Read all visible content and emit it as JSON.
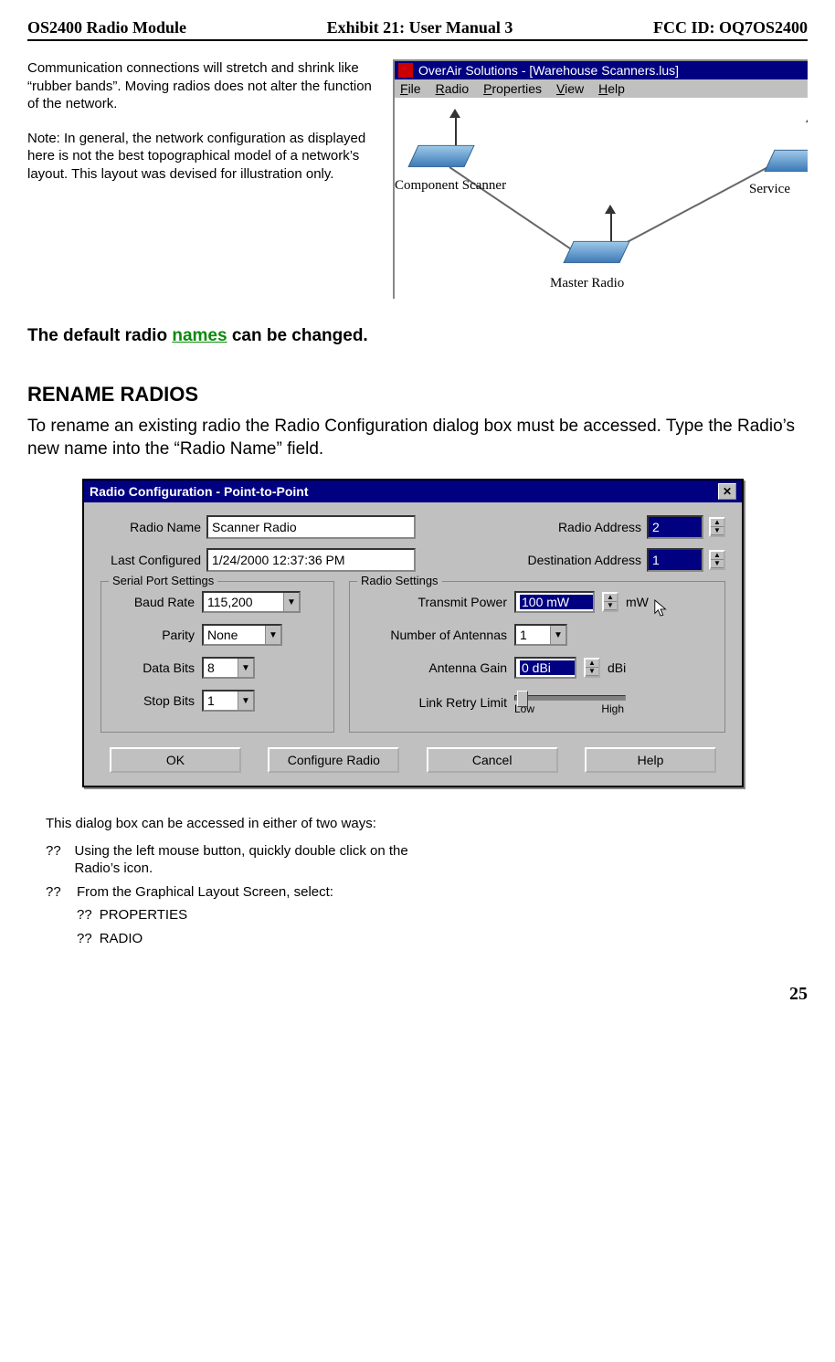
{
  "header": {
    "left": "OS2400 Radio Module",
    "center": "Exhibit 21: User Manual 3",
    "right": "FCC ID: OQ7OS2400"
  },
  "intro": {
    "p1": "Communication connections will stretch and shrink like “rubber bands”.  Moving radios does not alter the function of the network.",
    "p2": "Note:  In general, the network configuration as displayed here is not the best topographical model of a network’s layout.  This layout was devised for illustration only."
  },
  "appwindow": {
    "title": "OverAir Solutions - [Warehouse Scanners.lus]",
    "menu": {
      "file": "File",
      "radio": "Radio",
      "properties": "Properties",
      "view": "View",
      "help": "Help"
    },
    "labels": {
      "component": "Component Scanner",
      "master": "Master Radio",
      "service_prefix": "Service "
    }
  },
  "caption": {
    "pre": "The default radio ",
    "green": "names",
    "post": " can be changed."
  },
  "section_title": "RENAME RADIOS",
  "section_body": "To rename an existing radio the Radio Configuration dialog box must be accessed.  Type the Radio’s new name into the “Radio Name” field.",
  "dialog": {
    "title": "Radio Configuration - Point-to-Point",
    "labels": {
      "radio_name": "Radio Name",
      "radio_address": "Radio Address",
      "last_configured": "Last Configured",
      "destination_address": "Destination Address",
      "serial_group": "Serial Port Settings",
      "baud": "Baud Rate",
      "parity": "Parity",
      "databits": "Data Bits",
      "stopbits": "Stop Bits",
      "radio_group": "Radio Settings",
      "tx_power": "Transmit Power",
      "antennas": "Number of Antennas",
      "gain": "Antenna Gain",
      "retry": "Link Retry Limit",
      "low": "Low",
      "high": "High",
      "unit_mw": "mW",
      "unit_dbi": "dBi"
    },
    "values": {
      "radio_name": "Scanner Radio",
      "radio_address": "2",
      "last_configured": "1/24/2000 12:37:36 PM",
      "destination_address": "1",
      "baud": "115,200",
      "parity": "None",
      "databits": "8",
      "stopbits": "1",
      "tx_power": "100 mW",
      "antennas": "1",
      "gain": "0 dBi"
    },
    "buttons": {
      "ok": "OK",
      "configure": "Configure Radio",
      "cancel": "Cancel",
      "help": "Help"
    }
  },
  "access": {
    "intro": "This dialog box can be accessed in either of two ways:",
    "qq": "??",
    "q": "??",
    "b1": "Using the left mouse button, quickly double click on the Radio’s icon.",
    "b2": "From the Graphical Layout Screen, select:",
    "s1": "PROPERTIES",
    "s2": "RADIO"
  },
  "page_number": "25"
}
